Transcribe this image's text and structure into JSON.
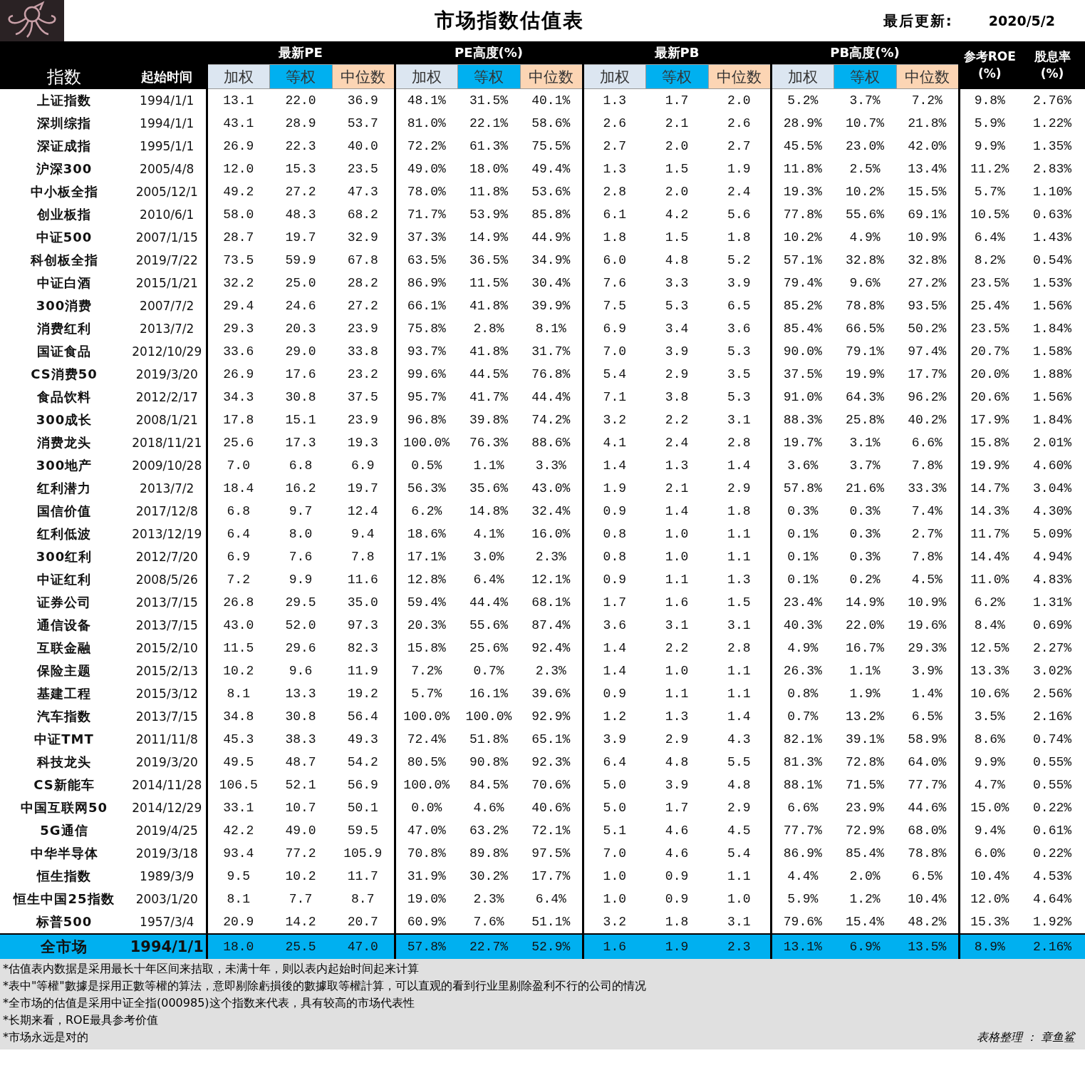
{
  "title": "市场指数估值表",
  "last_updated": {
    "label": "最后更新:",
    "value": "2020/5/2"
  },
  "header": {
    "name": "指数",
    "start": "起始时间",
    "groups": [
      {
        "label": "最新PE",
        "sub": [
          {
            "label": "加权",
            "color": "#dce6f1"
          },
          {
            "label": "等权",
            "color": "#00b0f0"
          },
          {
            "label": "中位数",
            "color": "#fcd5b4"
          }
        ]
      },
      {
        "label": "PE高度(%)",
        "sub": [
          {
            "label": "加权",
            "color": "#dce6f1"
          },
          {
            "label": "等权",
            "color": "#00b0f0"
          },
          {
            "label": "中位数",
            "color": "#fcd5b4"
          }
        ]
      },
      {
        "label": "最新PB",
        "sub": [
          {
            "label": "加权",
            "color": "#dce6f1"
          },
          {
            "label": "等权",
            "color": "#00b0f0"
          },
          {
            "label": "中位数",
            "color": "#fcd5b4"
          }
        ]
      },
      {
        "label": "PB高度(%)",
        "sub": [
          {
            "label": "加权",
            "color": "#dce6f1"
          },
          {
            "label": "等权",
            "color": "#00b0f0"
          },
          {
            "label": "中位数",
            "color": "#fcd5b4"
          }
        ]
      }
    ],
    "roe": {
      "label": "参考ROE",
      "unit": "(%)"
    },
    "dividend": {
      "label": "股息率",
      "unit": "(%)"
    }
  },
  "rows": [
    {
      "name": "上证指数",
      "start": "1994/1/1",
      "values": [
        "13.1",
        "22.0",
        "36.9",
        "48.1%",
        "31.5%",
        "40.1%",
        "1.3",
        "1.7",
        "2.0",
        "5.2%",
        "3.7%",
        "7.2%",
        "9.8%",
        "2.76%"
      ]
    },
    {
      "name": "深圳综指",
      "start": "1994/1/1",
      "values": [
        "43.1",
        "28.9",
        "53.7",
        "81.0%",
        "22.1%",
        "58.6%",
        "2.6",
        "2.1",
        "2.6",
        "28.9%",
        "10.7%",
        "21.8%",
        "5.9%",
        "1.22%"
      ]
    },
    {
      "name": "深证成指",
      "start": "1995/1/1",
      "values": [
        "26.9",
        "22.3",
        "40.0",
        "72.2%",
        "61.3%",
        "75.5%",
        "2.7",
        "2.0",
        "2.7",
        "45.5%",
        "23.0%",
        "42.0%",
        "9.9%",
        "1.35%"
      ]
    },
    {
      "name": "沪深300",
      "start": "2005/4/8",
      "values": [
        "12.0",
        "15.3",
        "23.5",
        "49.0%",
        "18.0%",
        "49.4%",
        "1.3",
        "1.5",
        "1.9",
        "11.8%",
        "2.5%",
        "13.4%",
        "11.2%",
        "2.83%"
      ]
    },
    {
      "name": "中小板全指",
      "start": "2005/12/1",
      "values": [
        "49.2",
        "27.2",
        "47.3",
        "78.0%",
        "11.8%",
        "53.6%",
        "2.8",
        "2.0",
        "2.4",
        "19.3%",
        "10.2%",
        "15.5%",
        "5.7%",
        "1.10%"
      ]
    },
    {
      "name": "创业板指",
      "start": "2010/6/1",
      "values": [
        "58.0",
        "48.3",
        "68.2",
        "71.7%",
        "53.9%",
        "85.8%",
        "6.1",
        "4.2",
        "5.6",
        "77.8%",
        "55.6%",
        "69.1%",
        "10.5%",
        "0.63%"
      ]
    },
    {
      "name": "中证500",
      "start": "2007/1/15",
      "values": [
        "28.7",
        "19.7",
        "32.9",
        "37.3%",
        "14.9%",
        "44.9%",
        "1.8",
        "1.5",
        "1.8",
        "10.2%",
        "4.9%",
        "10.9%",
        "6.4%",
        "1.43%"
      ]
    },
    {
      "name": "科创板全指",
      "start": "2019/7/22",
      "values": [
        "73.5",
        "59.9",
        "67.8",
        "63.5%",
        "36.5%",
        "34.9%",
        "6.0",
        "4.8",
        "5.2",
        "57.1%",
        "32.8%",
        "32.8%",
        "8.2%",
        "0.54%"
      ]
    },
    {
      "name": "中证白酒",
      "start": "2015/1/21",
      "values": [
        "32.2",
        "25.0",
        "28.2",
        "86.9%",
        "11.5%",
        "30.4%",
        "7.6",
        "3.3",
        "3.9",
        "79.4%",
        "9.6%",
        "27.2%",
        "23.5%",
        "1.53%"
      ]
    },
    {
      "name": "300消费",
      "start": "2007/7/2",
      "values": [
        "29.4",
        "24.6",
        "27.2",
        "66.1%",
        "41.8%",
        "39.9%",
        "7.5",
        "5.3",
        "6.5",
        "85.2%",
        "78.8%",
        "93.5%",
        "25.4%",
        "1.56%"
      ]
    },
    {
      "name": "消费红利",
      "start": "2013/7/2",
      "values": [
        "29.3",
        "20.3",
        "23.9",
        "75.8%",
        "2.8%",
        "8.1%",
        "6.9",
        "3.4",
        "3.6",
        "85.4%",
        "66.5%",
        "50.2%",
        "23.5%",
        "1.84%"
      ]
    },
    {
      "name": "国证食品",
      "start": "2012/10/29",
      "values": [
        "33.6",
        "29.0",
        "33.8",
        "93.7%",
        "41.8%",
        "31.7%",
        "7.0",
        "3.9",
        "5.3",
        "90.0%",
        "79.1%",
        "97.4%",
        "20.7%",
        "1.58%"
      ]
    },
    {
      "name": "CS消费50",
      "start": "2019/3/20",
      "values": [
        "26.9",
        "17.6",
        "23.2",
        "99.6%",
        "44.5%",
        "76.8%",
        "5.4",
        "2.9",
        "3.5",
        "37.5%",
        "19.9%",
        "17.7%",
        "20.0%",
        "1.88%"
      ]
    },
    {
      "name": "食品饮料",
      "start": "2012/2/17",
      "values": [
        "34.3",
        "30.8",
        "37.5",
        "95.7%",
        "41.7%",
        "44.4%",
        "7.1",
        "3.8",
        "5.3",
        "91.0%",
        "64.3%",
        "96.2%",
        "20.6%",
        "1.56%"
      ]
    },
    {
      "name": "300成长",
      "start": "2008/1/21",
      "values": [
        "17.8",
        "15.1",
        "23.9",
        "96.8%",
        "39.8%",
        "74.2%",
        "3.2",
        "2.2",
        "3.1",
        "88.3%",
        "25.8%",
        "40.2%",
        "17.9%",
        "1.84%"
      ]
    },
    {
      "name": "消费龙头",
      "start": "2018/11/21",
      "values": [
        "25.6",
        "17.3",
        "19.3",
        "100.0%",
        "76.3%",
        "88.6%",
        "4.1",
        "2.4",
        "2.8",
        "19.7%",
        "3.1%",
        "6.6%",
        "15.8%",
        "2.01%"
      ]
    },
    {
      "name": "300地产",
      "start": "2009/10/28",
      "values": [
        "7.0",
        "6.8",
        "6.9",
        "0.5%",
        "1.1%",
        "3.3%",
        "1.4",
        "1.3",
        "1.4",
        "3.6%",
        "3.7%",
        "7.8%",
        "19.9%",
        "4.60%"
      ]
    },
    {
      "name": "红利潜力",
      "start": "2013/7/2",
      "values": [
        "18.4",
        "16.2",
        "19.7",
        "56.3%",
        "35.6%",
        "43.0%",
        "1.9",
        "2.1",
        "2.9",
        "57.8%",
        "21.6%",
        "33.3%",
        "14.7%",
        "3.04%"
      ]
    },
    {
      "name": "国信价值",
      "start": "2017/12/8",
      "values": [
        "6.8",
        "9.7",
        "12.4",
        "6.2%",
        "14.8%",
        "32.4%",
        "0.9",
        "1.4",
        "1.8",
        "0.3%",
        "0.3%",
        "7.4%",
        "14.3%",
        "4.30%"
      ]
    },
    {
      "name": "红利低波",
      "start": "2013/12/19",
      "values": [
        "6.4",
        "8.0",
        "9.4",
        "18.6%",
        "4.1%",
        "16.0%",
        "0.8",
        "1.0",
        "1.1",
        "0.1%",
        "0.3%",
        "2.7%",
        "11.7%",
        "5.09%"
      ]
    },
    {
      "name": "300红利",
      "start": "2012/7/20",
      "values": [
        "6.9",
        "7.6",
        "7.8",
        "17.1%",
        "3.0%",
        "2.3%",
        "0.8",
        "1.0",
        "1.1",
        "0.1%",
        "0.3%",
        "7.8%",
        "14.4%",
        "4.94%"
      ]
    },
    {
      "name": "中证红利",
      "start": "2008/5/26",
      "values": [
        "7.2",
        "9.9",
        "11.6",
        "12.8%",
        "6.4%",
        "12.1%",
        "0.9",
        "1.1",
        "1.3",
        "0.1%",
        "0.2%",
        "4.5%",
        "11.0%",
        "4.83%"
      ]
    },
    {
      "name": "证券公司",
      "start": "2013/7/15",
      "values": [
        "26.8",
        "29.5",
        "35.0",
        "59.4%",
        "44.4%",
        "68.1%",
        "1.7",
        "1.6",
        "1.5",
        "23.4%",
        "14.9%",
        "10.9%",
        "6.2%",
        "1.31%"
      ]
    },
    {
      "name": "通信设备",
      "start": "2013/7/15",
      "values": [
        "43.0",
        "52.0",
        "97.3",
        "20.3%",
        "55.6%",
        "87.4%",
        "3.6",
        "3.1",
        "3.1",
        "40.3%",
        "22.0%",
        "19.6%",
        "8.4%",
        "0.69%"
      ]
    },
    {
      "name": "互联金融",
      "start": "2015/2/10",
      "values": [
        "11.5",
        "29.6",
        "82.3",
        "15.8%",
        "25.6%",
        "92.4%",
        "1.4",
        "2.2",
        "2.8",
        "4.9%",
        "16.7%",
        "29.3%",
        "12.5%",
        "2.27%"
      ]
    },
    {
      "name": "保险主题",
      "start": "2015/2/13",
      "values": [
        "10.2",
        "9.6",
        "11.9",
        "7.2%",
        "0.7%",
        "2.3%",
        "1.4",
        "1.0",
        "1.1",
        "26.3%",
        "1.1%",
        "3.9%",
        "13.3%",
        "3.02%"
      ]
    },
    {
      "name": "基建工程",
      "start": "2015/3/12",
      "values": [
        "8.1",
        "13.3",
        "19.2",
        "5.7%",
        "16.1%",
        "39.6%",
        "0.9",
        "1.1",
        "1.1",
        "0.8%",
        "1.9%",
        "1.4%",
        "10.6%",
        "2.56%"
      ]
    },
    {
      "name": "汽车指数",
      "start": "2013/7/15",
      "values": [
        "34.8",
        "30.8",
        "56.4",
        "100.0%",
        "100.0%",
        "92.9%",
        "1.2",
        "1.3",
        "1.4",
        "0.7%",
        "13.2%",
        "6.5%",
        "3.5%",
        "2.16%"
      ]
    },
    {
      "name": "中证TMT",
      "start": "2011/11/8",
      "values": [
        "45.3",
        "38.3",
        "49.3",
        "72.4%",
        "51.8%",
        "65.1%",
        "3.9",
        "2.9",
        "4.3",
        "82.1%",
        "39.1%",
        "58.9%",
        "8.6%",
        "0.74%"
      ]
    },
    {
      "name": "科技龙头",
      "start": "2019/3/20",
      "values": [
        "49.5",
        "48.7",
        "54.2",
        "80.5%",
        "90.8%",
        "92.3%",
        "6.4",
        "4.8",
        "5.5",
        "81.3%",
        "72.8%",
        "64.0%",
        "9.9%",
        "0.55%"
      ]
    },
    {
      "name": "CS新能车",
      "start": "2014/11/28",
      "values": [
        "106.5",
        "52.1",
        "56.9",
        "100.0%",
        "84.5%",
        "70.6%",
        "5.0",
        "3.9",
        "4.8",
        "88.1%",
        "71.5%",
        "77.7%",
        "4.7%",
        "0.55%"
      ]
    },
    {
      "name": "中国互联网50",
      "start": "2014/12/29",
      "values": [
        "33.1",
        "10.7",
        "50.1",
        "0.0%",
        "4.6%",
        "40.6%",
        "5.0",
        "1.7",
        "2.9",
        "6.6%",
        "23.9%",
        "44.6%",
        "15.0%",
        "0.22%"
      ]
    },
    {
      "name": "5G通信",
      "start": "2019/4/25",
      "values": [
        "42.2",
        "49.0",
        "59.5",
        "47.0%",
        "63.2%",
        "72.1%",
        "5.1",
        "4.6",
        "4.5",
        "77.7%",
        "72.9%",
        "68.0%",
        "9.4%",
        "0.61%"
      ]
    },
    {
      "name": "中华半导体",
      "start": "2019/3/18",
      "values": [
        "93.4",
        "77.2",
        "105.9",
        "70.8%",
        "89.8%",
        "97.5%",
        "7.0",
        "4.6",
        "5.4",
        "86.9%",
        "85.4%",
        "78.8%",
        "6.0%",
        "0.22%"
      ]
    },
    {
      "name": "恒生指数",
      "start": "1989/3/9",
      "values": [
        "9.5",
        "10.2",
        "11.7",
        "31.9%",
        "30.2%",
        "17.7%",
        "1.0",
        "0.9",
        "1.1",
        "4.4%",
        "2.0%",
        "6.5%",
        "10.4%",
        "4.53%"
      ]
    },
    {
      "name": "恒生中国25指数",
      "start": "2003/1/20",
      "values": [
        "8.1",
        "7.7",
        "8.7",
        "19.0%",
        "2.3%",
        "6.4%",
        "1.0",
        "0.9",
        "1.0",
        "5.9%",
        "1.2%",
        "10.4%",
        "12.0%",
        "4.64%"
      ]
    },
    {
      "name": "标普500",
      "start": "1957/3/4",
      "values": [
        "20.9",
        "14.2",
        "20.7",
        "60.9%",
        "7.6%",
        "51.1%",
        "3.2",
        "1.8",
        "3.1",
        "79.6%",
        "15.4%",
        "48.2%",
        "15.3%",
        "1.92%"
      ]
    }
  ],
  "total_row": {
    "name": "全市场",
    "start": "1994/1/1",
    "values": [
      "18.0",
      "25.5",
      "47.0",
      "57.8%",
      "22.7%",
      "52.9%",
      "1.6",
      "1.9",
      "2.3",
      "13.1%",
      "6.9%",
      "13.5%",
      "8.9%",
      "2.16%"
    ]
  },
  "notes": [
    "*估值表内数据是采用最长十年区间来拮取，未满十年，则以表内起始时间起来计算",
    "*表中\"等權\"數據是採用正數等權的算法，意即剔除虧損後的數據取等權計算，可以直观的看到行业里剔除盈利不行的公司的情况",
    "*全市场的估值是采用中证全指(000985)这个指数来代表，具有较高的市场代表性",
    "*长期来看，ROE最具参考价值",
    "*市场永远是对的"
  ],
  "credit": "表格整理 ： 章鱼鲨"
}
